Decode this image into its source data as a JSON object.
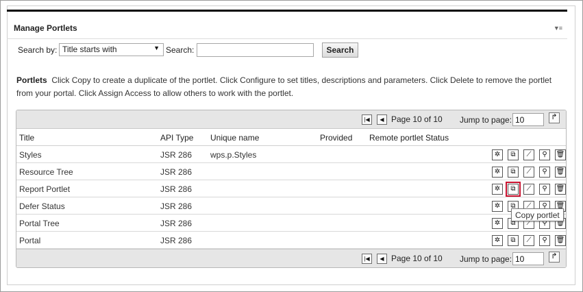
{
  "portlet": {
    "title": "Manage Portlets",
    "menu_icon": "menu-dropdown-icon"
  },
  "search": {
    "label": "Search by:",
    "select_value": "Title starts with",
    "search_label": "Search:",
    "input_value": "",
    "button_label": "Search"
  },
  "description": {
    "heading": "Portlets",
    "text": "Click Copy to create a duplicate of the portlet. Click Configure to set titles, descriptions and parameters. Click Delete to remove the portlet from your portal. Click Assign Access to allow others to work with the portlet."
  },
  "pager": {
    "page_text": "Page 10 of 10",
    "jump_label": "Jump to page:",
    "jump_value": "10"
  },
  "table": {
    "columns": [
      "Title",
      "API Type",
      "Unique name",
      "Provided",
      "Remote portlet",
      "Status"
    ],
    "rows": [
      {
        "title": "Styles",
        "api": "JSR 286",
        "unique": "wps.p.Styles",
        "provided": "",
        "remote": "",
        "status": ""
      },
      {
        "title": "Resource Tree",
        "api": "JSR 286",
        "unique": "",
        "provided": "",
        "remote": "",
        "status": ""
      },
      {
        "title": "Report Portlet",
        "api": "JSR 286",
        "unique": "",
        "provided": "",
        "remote": "",
        "status": ""
      },
      {
        "title": "Defer Status",
        "api": "JSR 286",
        "unique": "",
        "provided": "",
        "remote": "",
        "status": ""
      },
      {
        "title": "Portal Tree",
        "api": "JSR 286",
        "unique": "",
        "provided": "",
        "remote": "",
        "status": ""
      },
      {
        "title": "Portal",
        "api": "JSR 286",
        "unique": "",
        "provided": "",
        "remote": "",
        "status": ""
      }
    ],
    "actions": [
      "assign-access-icon",
      "copy-portlet-icon",
      "configure-icon",
      "settings-icon",
      "delete-icon"
    ]
  },
  "tooltip": {
    "text": "Copy portlet"
  },
  "colors": {
    "highlight": "#c8102e",
    "pager_bg": "#e6e6e6"
  }
}
